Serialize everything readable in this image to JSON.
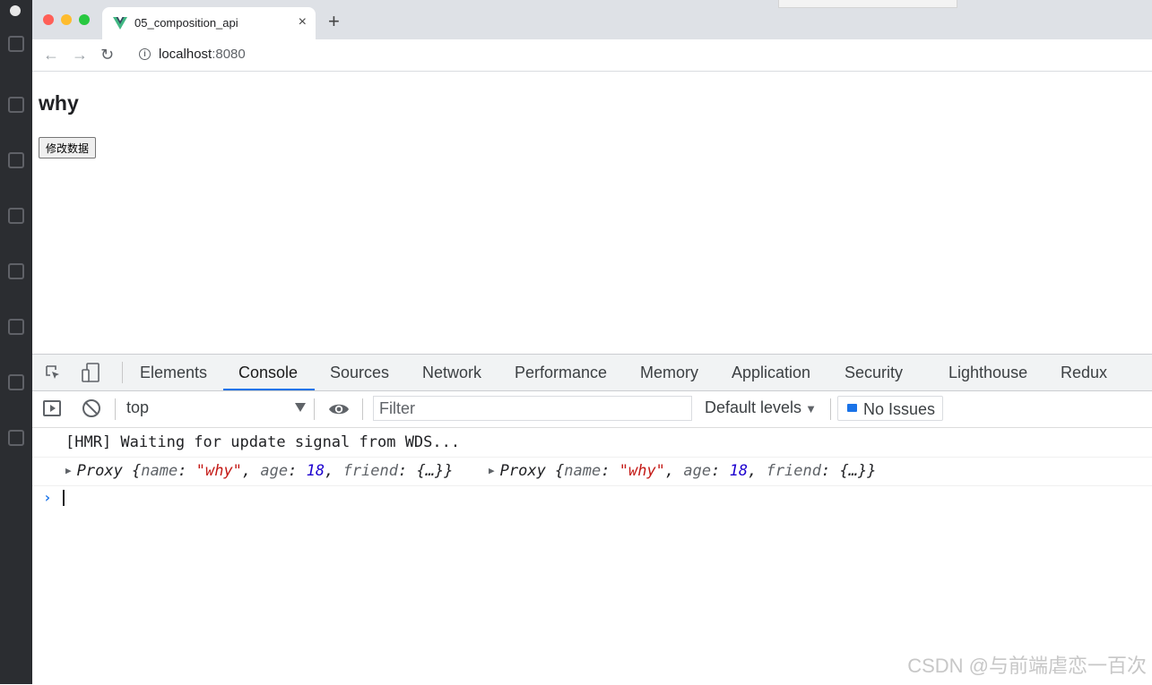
{
  "browser": {
    "tab_title": "05_composition_api",
    "tab_close": "×",
    "new_tab": "+",
    "url_host": "localhost",
    "url_port": ":8080",
    "nav": {
      "back": "←",
      "forward": "→",
      "reload": "↻"
    }
  },
  "page": {
    "heading": "why",
    "button_label": "修改数据"
  },
  "devtools": {
    "tabs": [
      "Elements",
      "Console",
      "Sources",
      "Network",
      "Performance",
      "Memory",
      "Application",
      "Security",
      "Lighthouse",
      "Redux"
    ],
    "active_tab": "Console",
    "console_toolbar": {
      "context": "top",
      "filter_placeholder": "Filter",
      "levels": "Default levels",
      "levels_caret": "▼",
      "issues": "No Issues"
    },
    "messages": [
      {
        "text": "[HMR] Waiting for update signal from WDS..."
      }
    ],
    "proxy_logs": [
      {
        "label": "Proxy",
        "name_key": "name",
        "name_val": "\"why\"",
        "age_key": "age",
        "age_val": "18",
        "friend_key": "friend",
        "friend_val": "{…}"
      },
      {
        "label": "Proxy",
        "name_key": "name",
        "name_val": "\"why\"",
        "age_key": "age",
        "age_val": "18",
        "friend_key": "friend",
        "friend_val": "{…}"
      }
    ],
    "prompt": "›"
  },
  "watermark": "CSDN @与前端虐恋一百次",
  "colors": {
    "accent": "#1a73e8",
    "string": "#c41a16",
    "number": "#1c00cf"
  }
}
